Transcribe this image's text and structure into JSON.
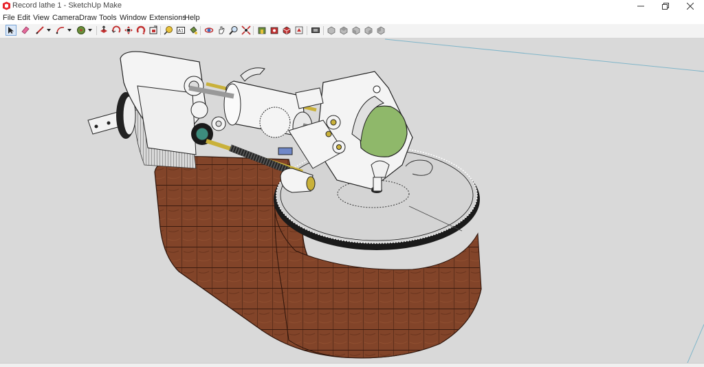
{
  "window": {
    "title": "Record lathe 1 - SketchUp Make"
  },
  "menu": [
    "File",
    "Edit",
    "View",
    "Camera",
    "Draw",
    "Tools",
    "Window",
    "Extensions",
    "Help"
  ],
  "toolbar": {
    "tools": [
      "select-tool-icon",
      "eraser-tool-icon",
      "pencil-line-tool-icon",
      "arc-tool-icon",
      "circle-tool-icon",
      "push-pull-tool-icon",
      "rotate-tool-icon",
      "move-tool-icon",
      "follow-me-tool-icon",
      "offset-tool-icon",
      "tape-measure-tool-icon",
      "dimension-tool-icon",
      "paint-bucket-tool-icon",
      "orbit-tool-icon",
      "pan-tool-icon",
      "zoom-tool-icon",
      "zoom-extents-tool-icon",
      "warehouse-icon",
      "extension-warehouse-icon",
      "component-icon",
      "layout-icon",
      "send-to-layout-icon",
      "view-iso-icon",
      "view-top-icon",
      "view-front-icon",
      "view-right-icon",
      "view-back-icon"
    ]
  },
  "colors": {
    "viewport_bg": "#d9d9d9",
    "wood": "#7a3e26",
    "platter": "#d4d4d4",
    "machine_white": "#f4f4f4",
    "brass": "#c9b13a",
    "green_cutter": "#8fb86a"
  }
}
